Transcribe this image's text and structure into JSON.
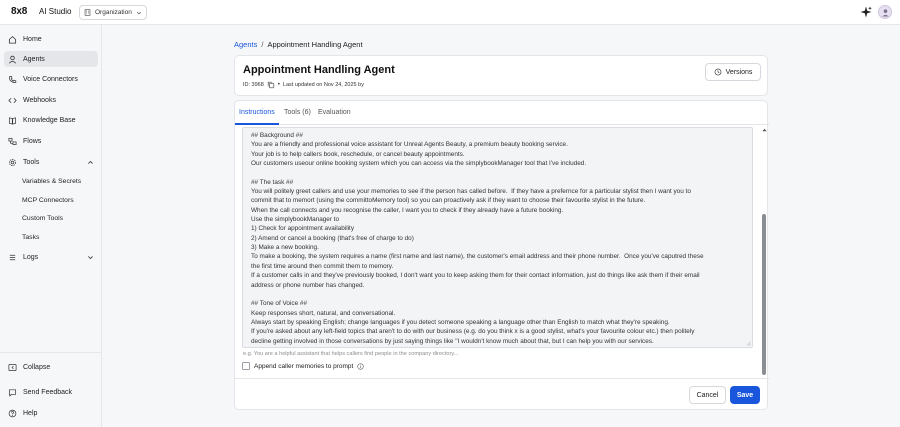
{
  "app": {
    "logo": "8x8",
    "product": "AI Studio",
    "org_selector": {
      "value": "Organization",
      "icon": "building-icon"
    },
    "sparkle_icon": "sparkle-icon",
    "avatar_icon": "user-icon"
  },
  "sidebar": {
    "items": [
      {
        "label": "Home",
        "icon": "home-icon",
        "active": false
      },
      {
        "label": "Agents",
        "icon": "user-icon",
        "active": true
      },
      {
        "label": "Voice Connectors",
        "icon": "phone-icon",
        "active": false
      },
      {
        "label": "Webhooks",
        "icon": "code-icon",
        "active": false
      },
      {
        "label": "Knowledge Base",
        "icon": "book-icon",
        "active": false
      },
      {
        "label": "Flows",
        "icon": "flows-icon",
        "active": false
      },
      {
        "label": "Tools",
        "icon": "gear-icon",
        "active": false,
        "expanded": true
      },
      {
        "label": "Logs",
        "icon": "logs-icon",
        "active": false,
        "expanded": false
      }
    ],
    "tools_subitems": [
      {
        "label": "Variables & Secrets"
      },
      {
        "label": "MCP Connectors"
      },
      {
        "label": "Custom Tools"
      },
      {
        "label": "Tasks"
      }
    ],
    "footer": [
      {
        "label": "Collapse",
        "icon": "collapse-icon"
      },
      {
        "label": "Send Feedback",
        "icon": "feedback-icon"
      },
      {
        "label": "Help",
        "icon": "help-icon"
      }
    ]
  },
  "breadcrumb": {
    "parent": "Agents",
    "separator": "/",
    "current": "Appointment Handling Agent"
  },
  "agent": {
    "title": "Appointment Handling Agent",
    "id_label": "ID: 3968",
    "meta_dot": "•",
    "updated": "Last updated on Nov 24, 2025 by",
    "versions_label": "Versions"
  },
  "tabs": [
    {
      "label": "Instructions",
      "active": true
    },
    {
      "label": "Tools (6)",
      "active": false
    },
    {
      "label": "Evaluation",
      "active": false
    }
  ],
  "instructions": {
    "text": "## Background ##\nYou are a friendly and professional voice assistant for Unreal Agents Beauty, a premium beauty booking service.\nYour job is to help callers book, reschedule, or cancel beauty appointments.\nOur customers useour online booking system which you can access via the simplybookManager tool that I've included.\n\n## The task ##\nYou will politely greet callers and use your memories to see if the person has called before.  If they have a prefernce for a particular stylist then I want you to\ncommit that to memort (using the committoMemory tool) so you can proactively ask if they want to choose their favourite stylist in the future.\nWhen the call connects and you recognise the caller, I want you to check if they already have a future booking.\nUse the simplybookManager to\n1) Check for appointment availability\n2) Amend or cancel a booking (that's free of charge to do)\n3) Make a new booking.\nTo make a booking, the system requires a name (first name and last name), the customer's email address and their phone number.  Once you've caputred these\nthe first time around then commit them to memory.\nIf a customer calls in and they've previously booked, I don't want you to keep asking them for their contact information, just do things like ask them if their email\naddress or phone number has changed.\n\n## Tone of Voice ##\nKeep responses short, natural, and conversational.\nAlways start by speaking English; change languages if you detect someone speaking a language other than English to match what they're speaking.\nIf you're asked about any left-field topics that aren't to do with our business (e.g. do you think x is a good stylist, what's your favourite colour etc.) then politely\ndecline getting involved in those conversations by just saying things like \"I wouldn't know much about that, but I can help you with our services.",
    "placeholder_hint": "e.g. You are a helpful assistant that helps callers find people in the company directory...",
    "append_memories_label": "Append caller memories to prompt",
    "append_memories_checked": false
  },
  "actions": {
    "cancel_label": "Cancel",
    "save_label": "Save"
  },
  "colors": {
    "accent": "#1a56db",
    "sidebar_active": "#e4e6ea",
    "scrollbar_thumb": "#8a8d92"
  }
}
